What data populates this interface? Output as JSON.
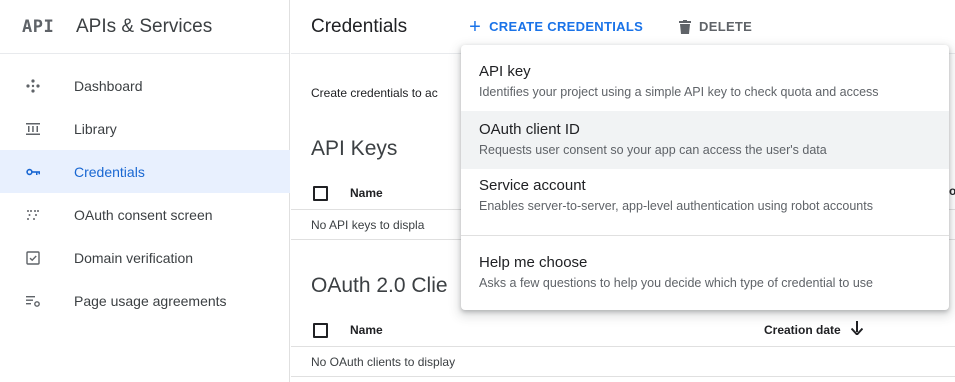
{
  "sidebar": {
    "logo": "API",
    "title": "APIs & Services",
    "items": [
      {
        "label": "Dashboard",
        "icon": "dashboard-icon"
      },
      {
        "label": "Library",
        "icon": "library-icon"
      },
      {
        "label": "Credentials",
        "icon": "key-icon",
        "active": true
      },
      {
        "label": "OAuth consent screen",
        "icon": "consent-screen-icon"
      },
      {
        "label": "Domain verification",
        "icon": "checkbox-icon"
      },
      {
        "label": "Page usage agreements",
        "icon": "settings-list-icon"
      }
    ]
  },
  "toolbar": {
    "title": "Credentials",
    "create_icon": "+",
    "create_label": "CREATE CREDENTIALS",
    "delete_label": "DELETE"
  },
  "main": {
    "intro": "Create credentials to ac",
    "api_keys": {
      "title": "API Keys",
      "col_name": "Name",
      "col_fragment": "o",
      "empty": "No API keys to displa"
    },
    "oauth": {
      "title": "OAuth 2.0 Clie",
      "col_name": "Name",
      "col_date": "Creation date",
      "sort_arrow": "🡓",
      "empty": "No OAuth clients to display"
    }
  },
  "menu": {
    "items": [
      {
        "title": "API key",
        "desc": "Identifies your project using a simple API key to check quota and access"
      },
      {
        "title": "OAuth client ID",
        "desc": "Requests user consent so your app can access the user's data"
      },
      {
        "title": "Service account",
        "desc": "Enables server-to-server, app-level authentication using robot accounts"
      },
      {
        "title": "Help me choose",
        "desc": "Asks a few questions to help you decide which type of credential to use"
      }
    ]
  },
  "colors": {
    "accent": "#1a73e8",
    "active_bg": "#e8f0fe",
    "hover_bg": "#f1f3f4"
  }
}
